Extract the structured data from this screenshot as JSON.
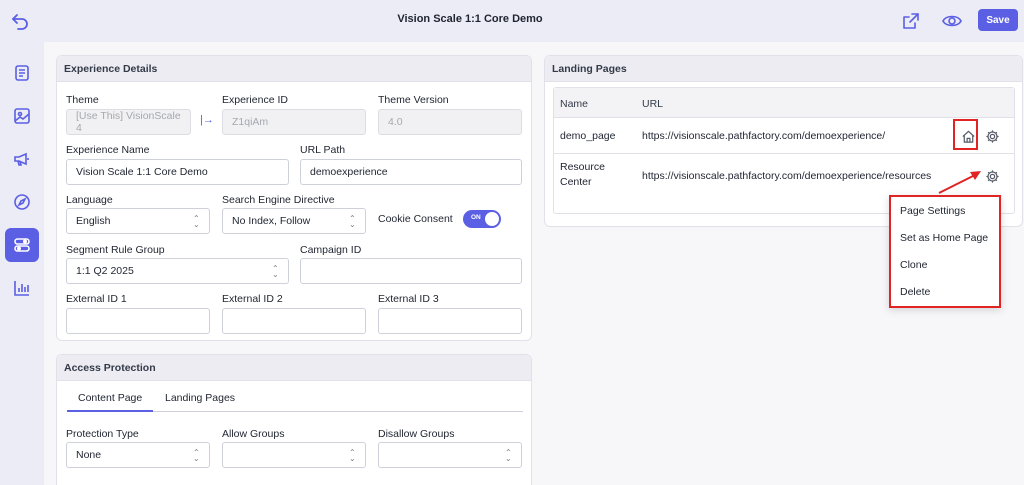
{
  "header": {
    "title": "Vision Scale 1:1 Core Demo",
    "save_label": "Save"
  },
  "sidebar": {
    "items": [
      {
        "icon": "document-icon"
      },
      {
        "icon": "image-icon"
      },
      {
        "icon": "megaphone-icon"
      },
      {
        "icon": "compass-icon"
      },
      {
        "icon": "toggles-icon",
        "active": true
      },
      {
        "icon": "bar-chart-icon"
      }
    ]
  },
  "experience": {
    "title": "Experience Details",
    "theme_label": "Theme",
    "theme_value": "[Use This] VisionScale 4",
    "experience_id_label": "Experience ID",
    "experience_id_value": "Z1qiAm",
    "theme_version_label": "Theme Version",
    "theme_version_value": "4.0",
    "experience_name_label": "Experience Name",
    "experience_name_value": "Vision Scale 1:1 Core Demo",
    "url_path_label": "URL Path",
    "url_path_value": "demoexperience",
    "language_label": "Language",
    "language_value": "English",
    "search_directive_label": "Search Engine Directive",
    "search_directive_value": "No Index, Follow",
    "cookie_consent_label": "Cookie Consent",
    "cookie_consent_state": "ON",
    "segment_label": "Segment Rule Group",
    "segment_value": "1:1 Q2 2025",
    "campaign_label": "Campaign ID",
    "campaign_value": "",
    "ext1_label": "External ID 1",
    "ext1_value": "",
    "ext2_label": "External ID 2",
    "ext2_value": "",
    "ext3_label": "External ID 3",
    "ext3_value": ""
  },
  "access": {
    "title": "Access Protection",
    "tabs": [
      "Content Page",
      "Landing Pages"
    ],
    "protection_type_label": "Protection Type",
    "protection_type_value": "None",
    "allow_groups_label": "Allow Groups",
    "allow_groups_value": "",
    "disallow_groups_label": "Disallow Groups",
    "disallow_groups_value": ""
  },
  "landing": {
    "title": "Landing Pages",
    "columns": [
      "Name",
      "URL"
    ],
    "rows": [
      {
        "name": "demo_page",
        "url": "https://visionscale.pathfactory.com/demoexperience/"
      },
      {
        "name_line1": "Resource",
        "name_line2": "Center",
        "url": "https://visionscale.pathfactory.com/demoexperience/resources"
      }
    ]
  },
  "context_menu": {
    "items": [
      "Page Settings",
      "Set as Home Page",
      "Clone",
      "Delete"
    ]
  },
  "colors": {
    "accent": "#5b5fe3",
    "highlight": "#e02424"
  }
}
